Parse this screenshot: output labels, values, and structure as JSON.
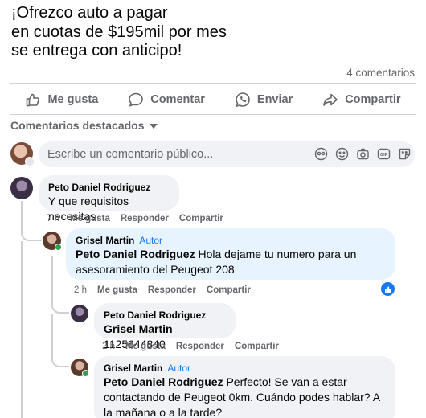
{
  "post": {
    "lines": [
      "¡Ofrezco auto a pagar",
      "en cuotas de $195mil por mes",
      "se entrega con anticipo!"
    ],
    "comment_count": "4 comentarios"
  },
  "actions": {
    "like": "Me gusta",
    "comment": "Comentar",
    "send": "Enviar",
    "share": "Compartir"
  },
  "sort_label": "Comentarios destacados",
  "input": {
    "placeholder": "Escribe un comentario público..."
  },
  "comments": [
    {
      "author": "Peto Daniel Rodriguez",
      "text": "Y que requisitos necesitas",
      "time": "7 h",
      "like": "Me gusta",
      "reply": "Responder",
      "share": "Compartir"
    },
    {
      "author": "Grisel Martin",
      "badge": "Autor",
      "mention": "Peto Daniel Rodriguez",
      "text": " Hola dejame tu numero para un asesoramiento del Peugeot 208",
      "time": "2 h",
      "like": "Me gusta",
      "reply": "Responder",
      "share": "Compartir"
    },
    {
      "author": "Peto Daniel Rodriguez",
      "mention": "Grisel Martin",
      "text": " 1125644840",
      "time": "2 h",
      "like": "Me gusta",
      "reply": "Responder",
      "share": "Compartir"
    },
    {
      "author": "Grisel Martin",
      "badge": "Autor",
      "mention": "Peto Daniel Rodriguez",
      "text": " Perfecto! Se van a estar contactando de Peugeot 0km. Cuándo podes hablar? A la mañana o a la tarde?"
    }
  ],
  "colors": {
    "accent": "#1877f2",
    "bubble": "#f0f2f5",
    "author_bubble": "#e7f3ff",
    "muted": "#65676b"
  }
}
